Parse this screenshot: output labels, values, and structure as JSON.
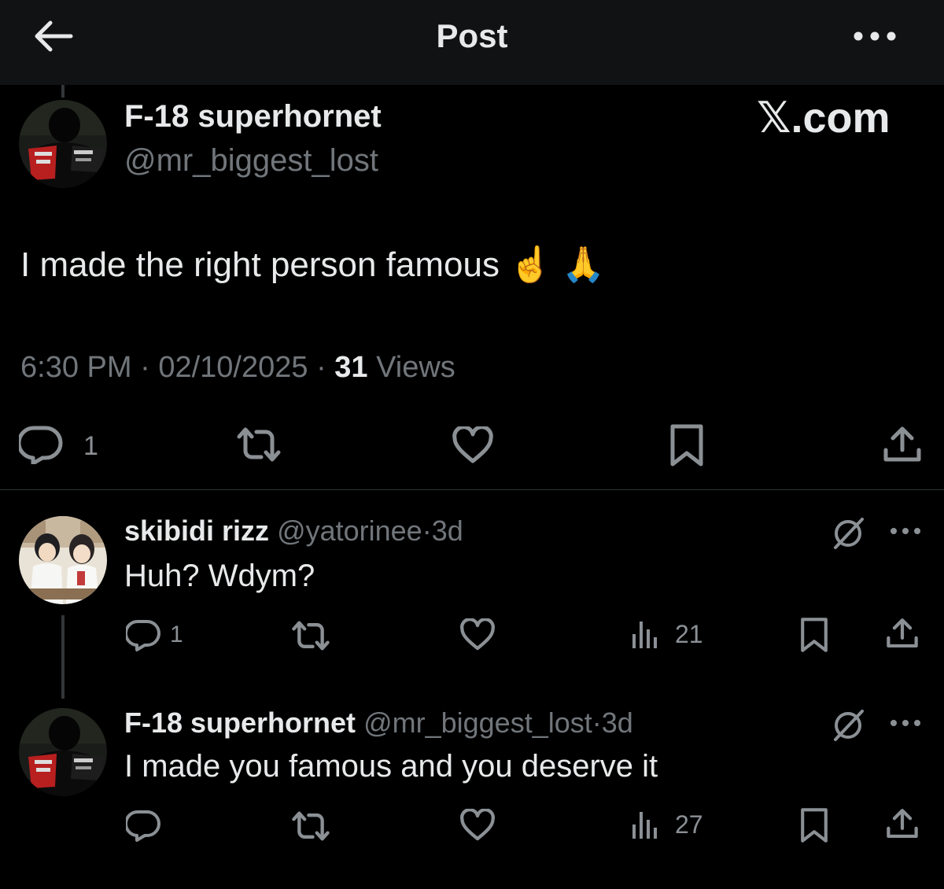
{
  "header": {
    "title": "Post",
    "back_icon": "arrow-left-icon",
    "more_icon": "more-horizontal-icon"
  },
  "watermark": "𝕏.com",
  "main_post": {
    "display_name": "F-18 superhornet",
    "handle": "@mr_biggest_lost",
    "text": "I made the right person famous ☝️ 🙏",
    "time": "6:30 PM",
    "date": "02/10/2025",
    "views_count": "31",
    "views_label": "Views",
    "reply_count": "1",
    "sep": "·"
  },
  "replies": [
    {
      "display_name": "skibidi rizz",
      "handle": "@yatorinee",
      "age": "3d",
      "text": "Huh? Wdym?",
      "reply_count": "1",
      "views": "21"
    },
    {
      "display_name": "F-18 superhornet",
      "handle": "@mr_biggest_lost",
      "age": "3d",
      "text": "I made you famous and you deserve it",
      "reply_count": "",
      "views": "27"
    }
  ],
  "colors": {
    "background": "#000000",
    "header": "#111213",
    "text": "#e7e9ea",
    "muted": "#71767b"
  }
}
